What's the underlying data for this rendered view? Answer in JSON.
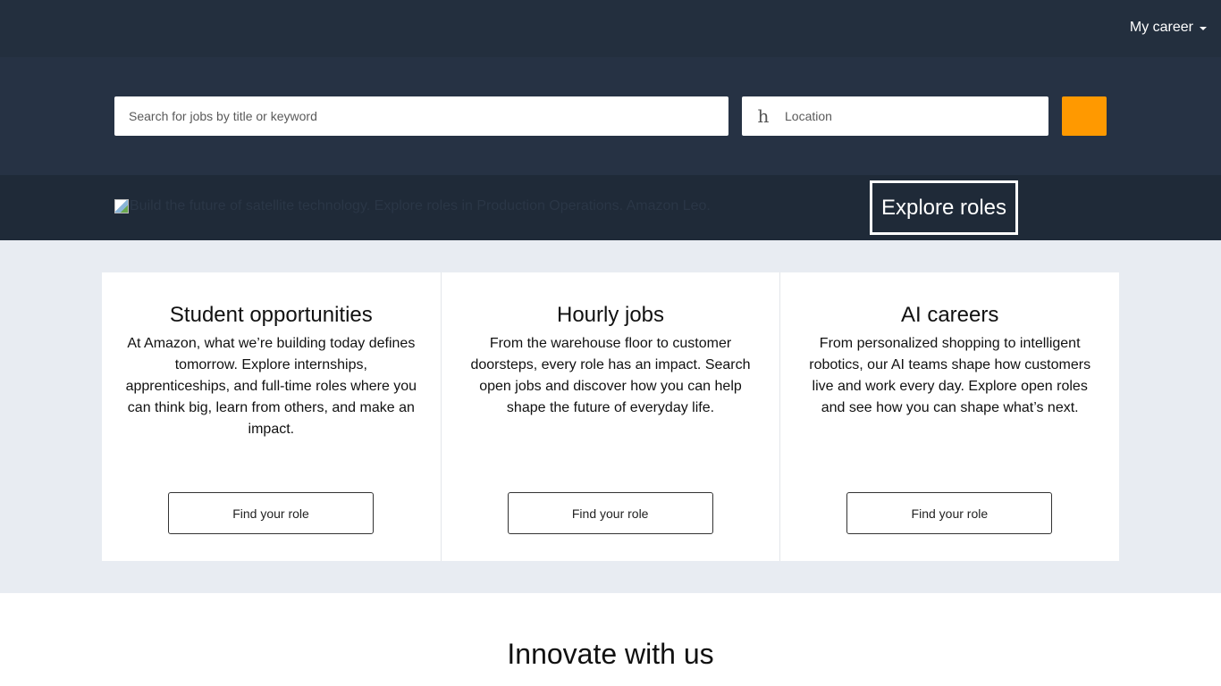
{
  "header": {
    "menu_label": "My career"
  },
  "search": {
    "keyword_placeholder": "Search for jobs by title or keyword",
    "location_icon_glyph": "h",
    "location_placeholder": "Location",
    "button_color": "#ff9900"
  },
  "promo": {
    "image_alt": "Build the future of satellite technology. Explore roles in Production Operations. Amazon Leo.",
    "button_label": "Explore roles"
  },
  "cards": [
    {
      "title": "Student opportunities",
      "text": "At Amazon, what we’re building today defines tomorrow. Explore internships, apprenticeships, and full-time roles where you can think big, learn from others, and make an impact.",
      "button": "Find your role"
    },
    {
      "title": "Hourly jobs",
      "text": "From the warehouse floor to customer doorsteps, every role has an impact. Search open jobs and discover how you can help shape the future of everyday life.",
      "button": "Find your role"
    },
    {
      "title": "AI careers",
      "text": "From personalized shopping to intelligent robotics, our AI teams shape how customers live and work every day. Explore open roles and see how you can shape what’s next.",
      "button": "Find your role"
    }
  ],
  "section": {
    "innovate_title": "Innovate with us"
  },
  "colors": {
    "topbar": "#232f3e",
    "search_band": "#263244",
    "promo_band": "#1f2a38",
    "cards_band": "#e8ecf2"
  }
}
